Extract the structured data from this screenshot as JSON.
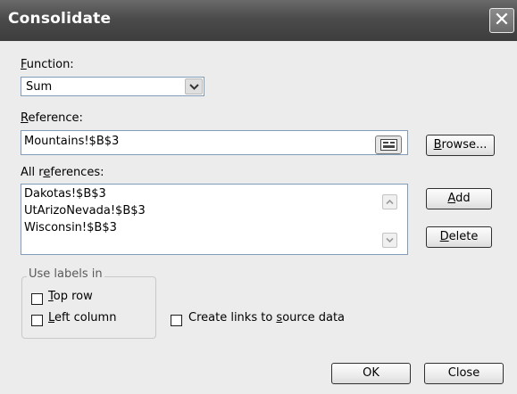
{
  "window": {
    "title": "Consolidate",
    "close_glyph": "✕"
  },
  "function": {
    "label_key": "F",
    "label_rest": "unction:",
    "value": "Sum"
  },
  "reference": {
    "label_key": "R",
    "label_rest": "eference:",
    "value": "Mountains!$B$3"
  },
  "browse_button": {
    "label_key": "B",
    "label_rest": "rowse..."
  },
  "all_references": {
    "label_pre": "All r",
    "label_key": "e",
    "label_rest": "ferences:",
    "items": [
      "Dakotas!$B$3",
      "UtArizoNevada!$B$3",
      "Wisconsin!$B$3"
    ]
  },
  "add_button": {
    "label_key": "A",
    "label_rest": "dd"
  },
  "delete_button": {
    "label_key": "D",
    "label_rest": "elete"
  },
  "use_labels": {
    "title": "Use labels in",
    "top_row": {
      "label_key": "T",
      "label_rest": "op row",
      "checked": false
    },
    "left_column": {
      "label_key": "L",
      "label_rest": "eft column",
      "checked": false
    }
  },
  "create_links": {
    "label_pre": "Create links to ",
    "label_key": "s",
    "label_rest": "ource data",
    "checked": false
  },
  "ok_button": {
    "label": "OK"
  },
  "close_button": {
    "label": "Close"
  },
  "icons": {
    "dropdown": "chevron-down-icon",
    "collapse_dialog": "collapse-dialog-icon",
    "scroll_up": "scroll-up-icon",
    "scroll_down": "scroll-down-icon"
  }
}
